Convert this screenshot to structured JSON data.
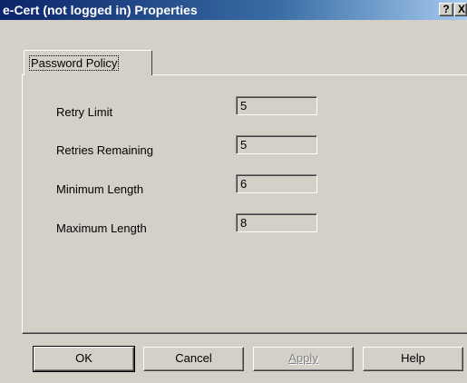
{
  "window": {
    "title": "e-Cert (not logged in) Properties",
    "help_glyph": "?",
    "close_glyph": "X"
  },
  "tabs": [
    {
      "label": "Password Policy",
      "selected": true
    }
  ],
  "fields": [
    {
      "label": "Retry Limit",
      "value": "5"
    },
    {
      "label": "Retries Remaining",
      "value": "5"
    },
    {
      "label": "Minimum Length",
      "value": "6"
    },
    {
      "label": "Maximum Length",
      "value": "8"
    }
  ],
  "buttons": {
    "ok": "OK",
    "cancel": "Cancel",
    "apply": "Apply",
    "help": "Help"
  }
}
